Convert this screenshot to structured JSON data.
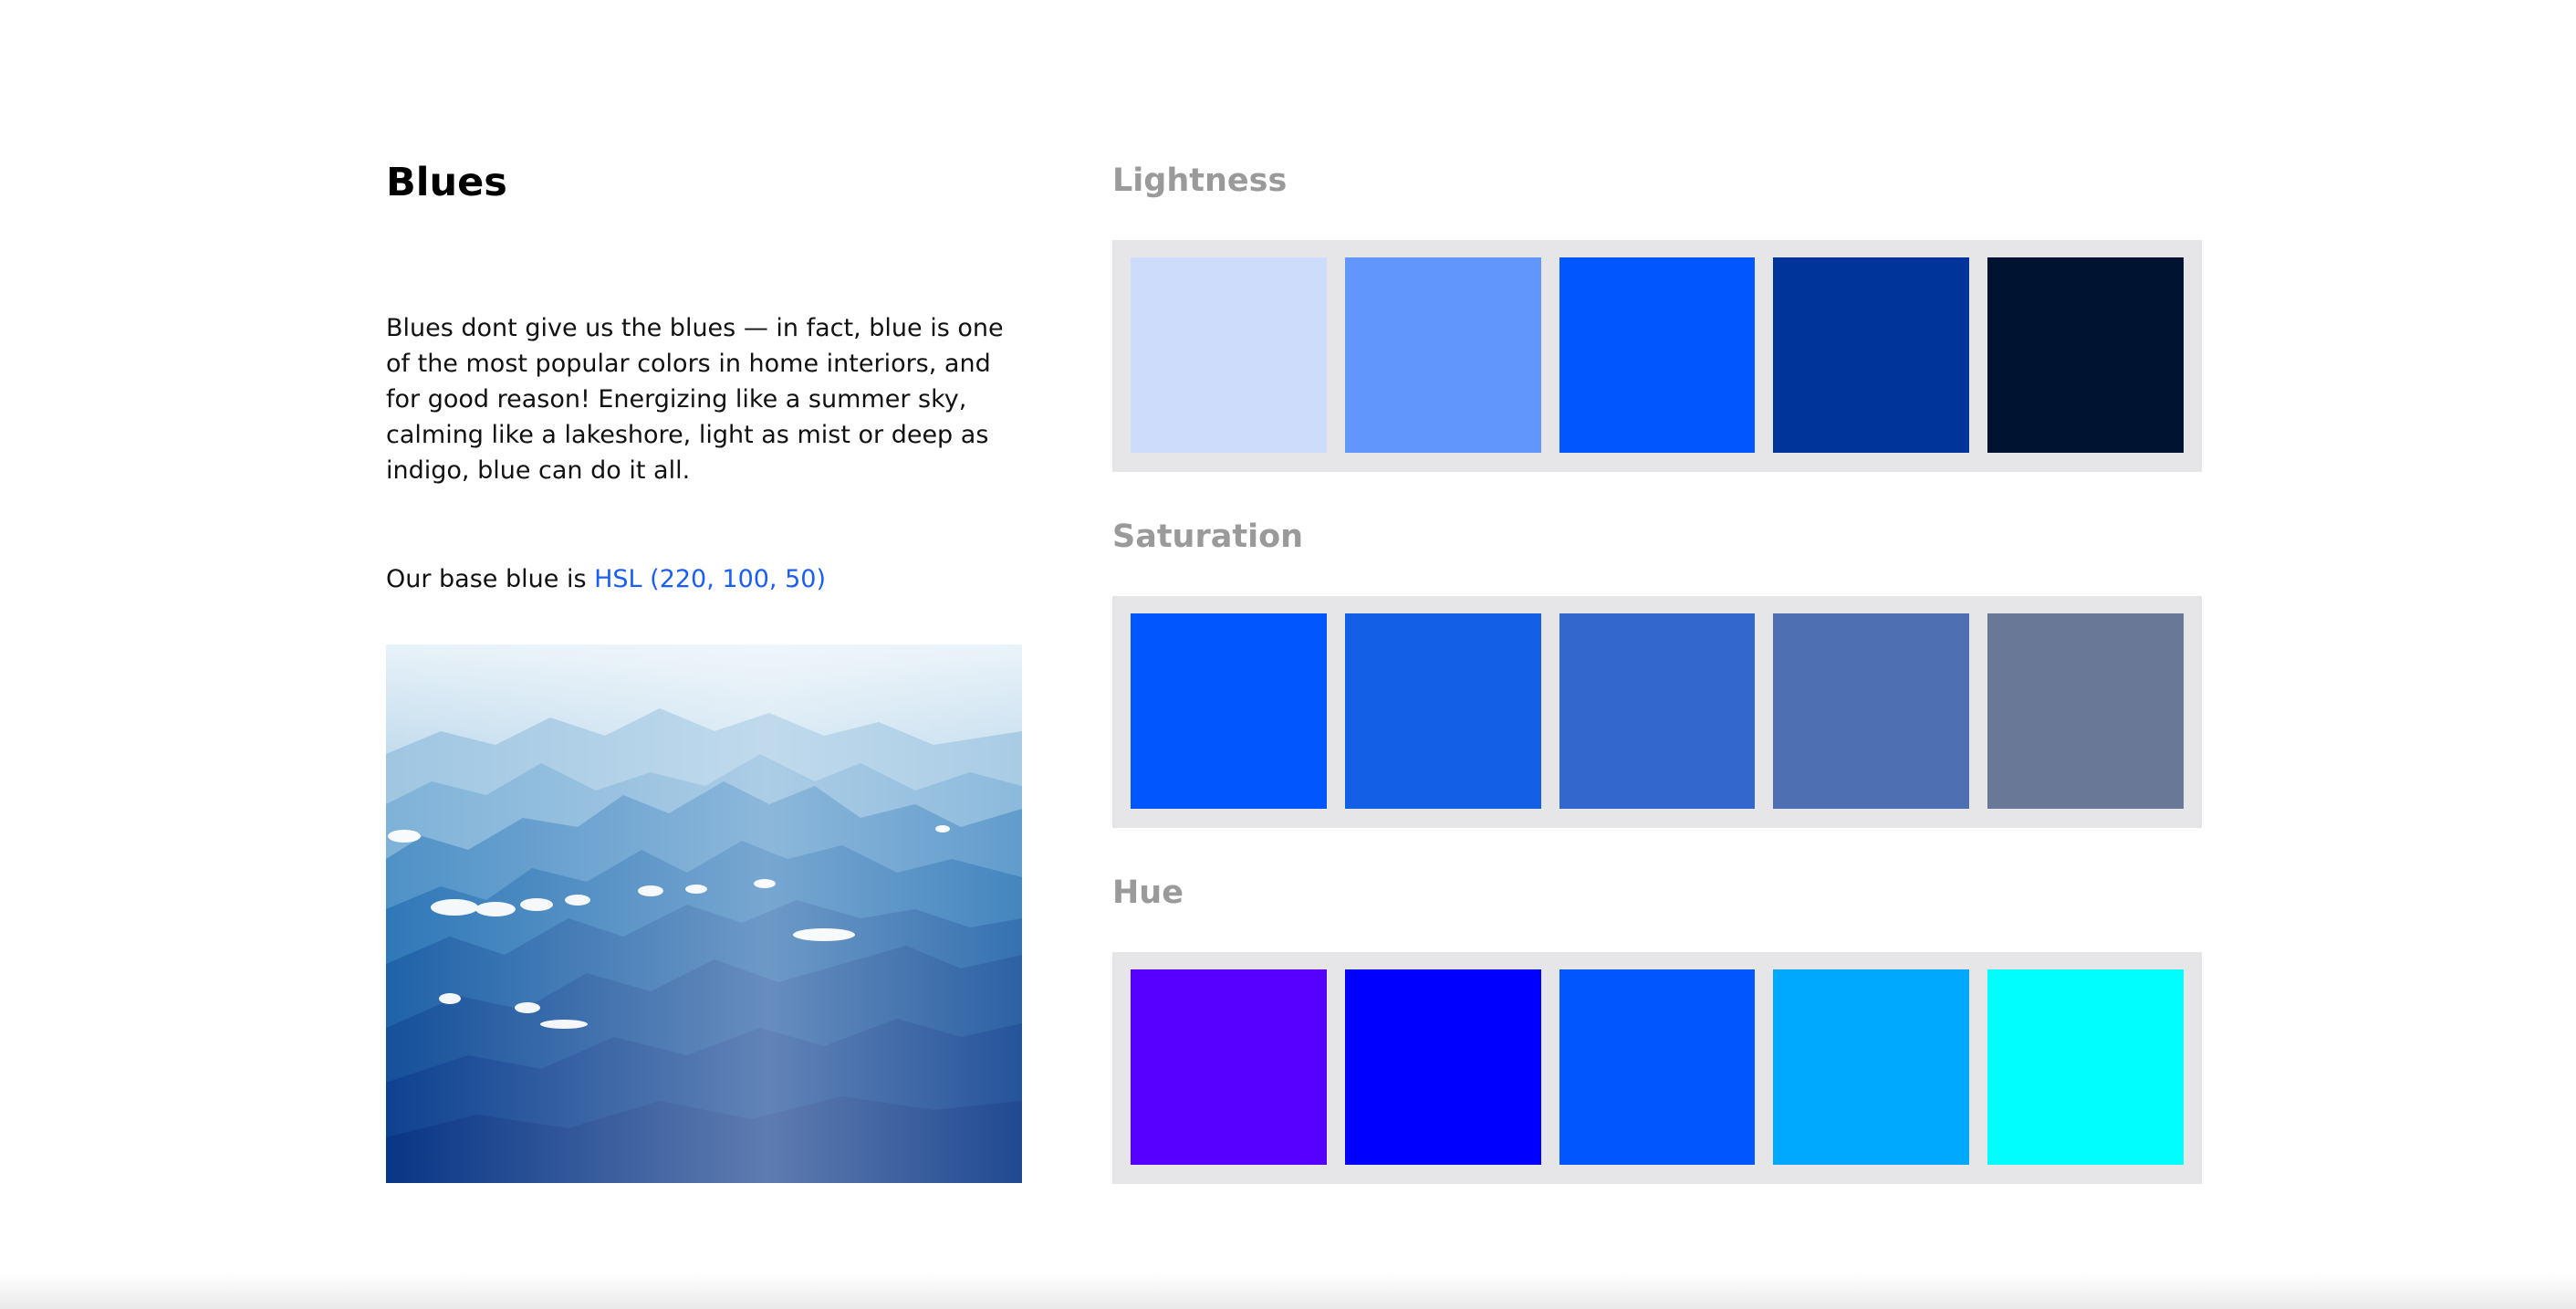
{
  "title": "Blues",
  "description": "Blues dont give us the blues — in fact, blue is one of the most popular colors in home interiors, and for good reason! Energizing like a summer sky, calming like a lakeshore, light as mist or deep as indigo, blue can do it all.",
  "base_color": {
    "prefix": "Our base blue is ",
    "link_text": "HSL (220, 100, 50)",
    "link_color": "#1a5ef5"
  },
  "image": {
    "description_icon": "mountain-landscape-image"
  },
  "sections": [
    {
      "label": "Lightness",
      "swatches": [
        "#cddcfb",
        "#6197fc",
        "#0256fe",
        "#00349a",
        "#001330"
      ]
    },
    {
      "label": "Saturation",
      "swatches": [
        "#0256fe",
        "#1360e6",
        "#3367cd",
        "#4e70b2",
        "#697897"
      ]
    },
    {
      "label": "Hue",
      "swatches": [
        "#5600ff",
        "#0000fe",
        "#0256fe",
        "#00a8fe",
        "#00feff"
      ]
    }
  ]
}
